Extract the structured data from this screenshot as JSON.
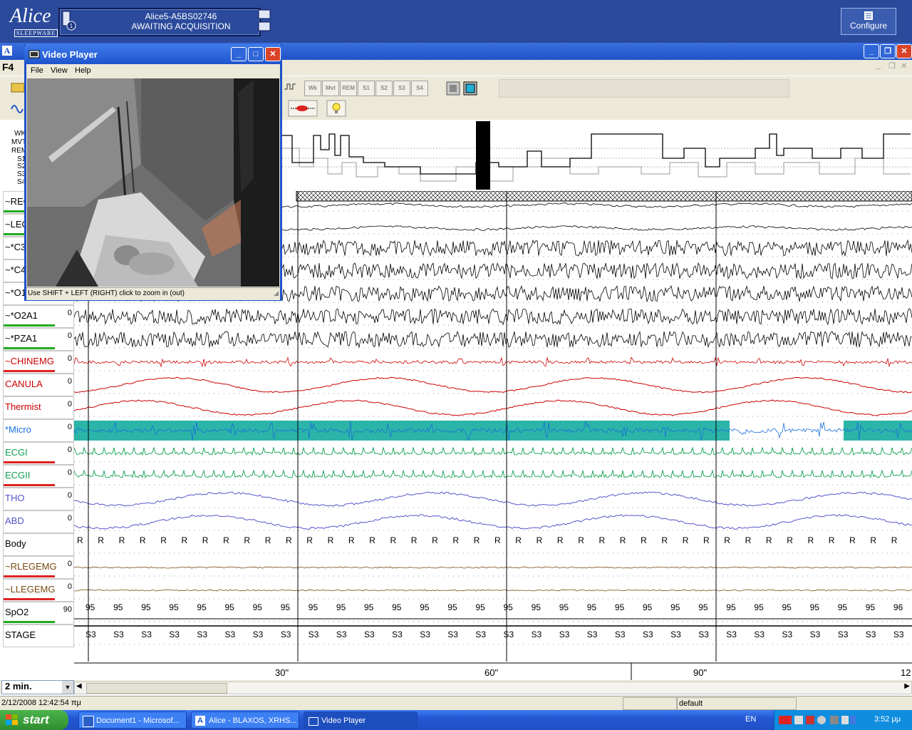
{
  "alice": {
    "logo": "Alice",
    "logo_sub": "SLEEPWARE",
    "device_id": "Alice5-A5BS02746",
    "device_status": "AWAITING ACQUISITION",
    "configure_label": "Configure"
  },
  "main_window": {
    "caption_prefix": "A",
    "montage_key": "F4"
  },
  "toolbar": {
    "stage_buttons": [
      "Wk",
      "Mvt",
      "REM",
      "S1",
      "S2",
      "S3",
      "S4"
    ]
  },
  "hypnogram": {
    "stage_labels": [
      "WK",
      "MVT",
      "REM",
      "S1",
      "S2",
      "S3",
      "S4"
    ]
  },
  "channels": [
    {
      "name": "~REOG",
      "zero": "",
      "color": "#000000",
      "bar": "#22aa22"
    },
    {
      "name": "~LEOG",
      "zero": "",
      "color": "#000000",
      "bar": "#22aa22"
    },
    {
      "name": "~*C3A2",
      "zero": "",
      "color": "#000000",
      "bar": ""
    },
    {
      "name": "~*C4A1",
      "zero": "",
      "color": "#000000",
      "bar": ""
    },
    {
      "name": "~*O1A2",
      "zero": "",
      "color": "#000000",
      "bar": ""
    },
    {
      "name": "~*O2A1",
      "zero": "0",
      "color": "#000000",
      "bar": "#22aa22"
    },
    {
      "name": "~*PZA1",
      "zero": "0",
      "color": "#000000",
      "bar": "#22aa22"
    },
    {
      "name": "~CHINEMG",
      "zero": "0",
      "color": "#cc0000",
      "bar": "#dd2222"
    },
    {
      "name": "CANULA",
      "zero": "0",
      "color": "#cc0000",
      "bar": ""
    },
    {
      "name": "Thermist",
      "zero": "0",
      "color": "#cc0000",
      "bar": ""
    },
    {
      "name": "*Micro",
      "zero": "0",
      "color": "#1a6fd8",
      "bar": ""
    },
    {
      "name": "ECGI",
      "zero": "0",
      "color": "#12a050",
      "bar": "#dd2222"
    },
    {
      "name": "ECGII",
      "zero": "0",
      "color": "#12a050",
      "bar": "#dd2222"
    },
    {
      "name": "THO",
      "zero": "0",
      "color": "#5555cc",
      "bar": ""
    },
    {
      "name": "ABD",
      "zero": "0",
      "color": "#5555cc",
      "bar": ""
    },
    {
      "name": "Body",
      "zero": "",
      "color": "#000000",
      "bar": ""
    },
    {
      "name": "~RLEGEMG",
      "zero": "0",
      "color": "#7a4a10",
      "bar": "#dd2222"
    },
    {
      "name": "~LLEGEMG",
      "zero": "0",
      "color": "#7a4a10",
      "bar": "#dd2222"
    },
    {
      "name": "SpO2",
      "zero": "90",
      "color": "#000000",
      "bar": "#22aa22"
    },
    {
      "name": "STAGE",
      "zero": "",
      "color": "#000000",
      "bar": ""
    }
  ],
  "body_position_marker": "R",
  "spo2_values": [
    "95",
    "95",
    "95",
    "95",
    "95",
    "95",
    "95",
    "95",
    "95",
    "95",
    "95",
    "95",
    "95",
    "95",
    "95",
    "95",
    "95",
    "95",
    "95",
    "95",
    "95",
    "95",
    "95",
    "95",
    "95",
    "95",
    "95",
    "95",
    "95",
    "96"
  ],
  "stage_value": "S3",
  "time_axis": {
    "ticks": [
      "30\"",
      "60\"",
      "90\"",
      "12"
    ]
  },
  "zoom": {
    "value": "2 min."
  },
  "status": {
    "datetime": "2/12/2008 12:42:54 πμ",
    "profile": "default"
  },
  "video_player": {
    "title": "Video Player",
    "menu": [
      "File",
      "View",
      "Help"
    ],
    "hint": "Use SHIFT + LEFT (RIGHT) click to zoom in (out)"
  },
  "taskbar": {
    "start": "start",
    "items": [
      "Document1 - Microsof...",
      "Alice - BLAXOS, XRHS...",
      "Video Player"
    ],
    "lang": "EN",
    "clock": "3:52 μμ"
  }
}
